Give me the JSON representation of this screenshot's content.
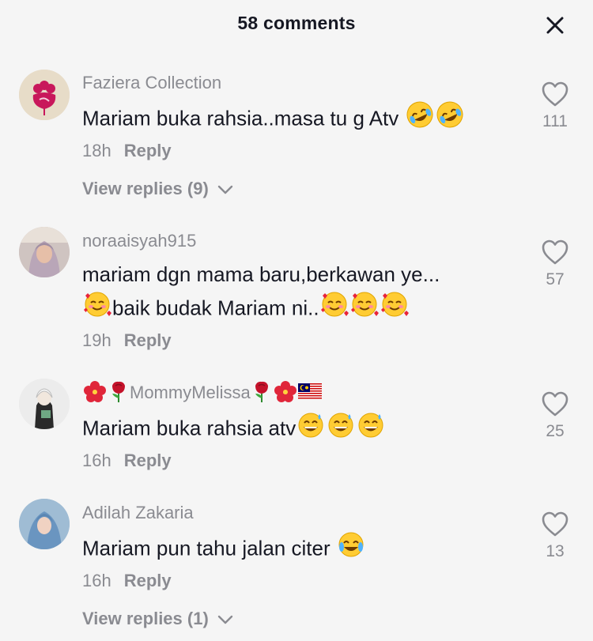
{
  "header": {
    "title": "58 comments",
    "close_icon": "close-icon"
  },
  "comments": [
    {
      "username": "Faziera Collection",
      "text": "Mariam buka rahsia..masa tu g Atv",
      "emojis_after": [
        "rofl",
        "rofl"
      ],
      "time": "18h",
      "reply": "Reply",
      "likes": "111",
      "view_replies": "View replies (9)"
    },
    {
      "username": "noraaisyah915",
      "text_line1": "mariam dgn mama baru,berkawan ye...",
      "text_line2": "baik budak Mariam ni..",
      "time": "19h",
      "reply": "Reply",
      "likes": "57"
    },
    {
      "username": "MommyMelissa",
      "text": "Mariam buka rahsia atv",
      "time": "16h",
      "reply": "Reply",
      "likes": "25"
    },
    {
      "username": "Adilah Zakaria",
      "text": "Mariam pun tahu jalan citer",
      "time": "16h",
      "reply": "Reply",
      "likes": "13",
      "view_replies": "View replies (1)"
    }
  ],
  "colors": {
    "background": "#f5f5f5",
    "primary_text": "#161823",
    "secondary_text": "#8a8b91",
    "brand_avatar": "#c8175b"
  }
}
